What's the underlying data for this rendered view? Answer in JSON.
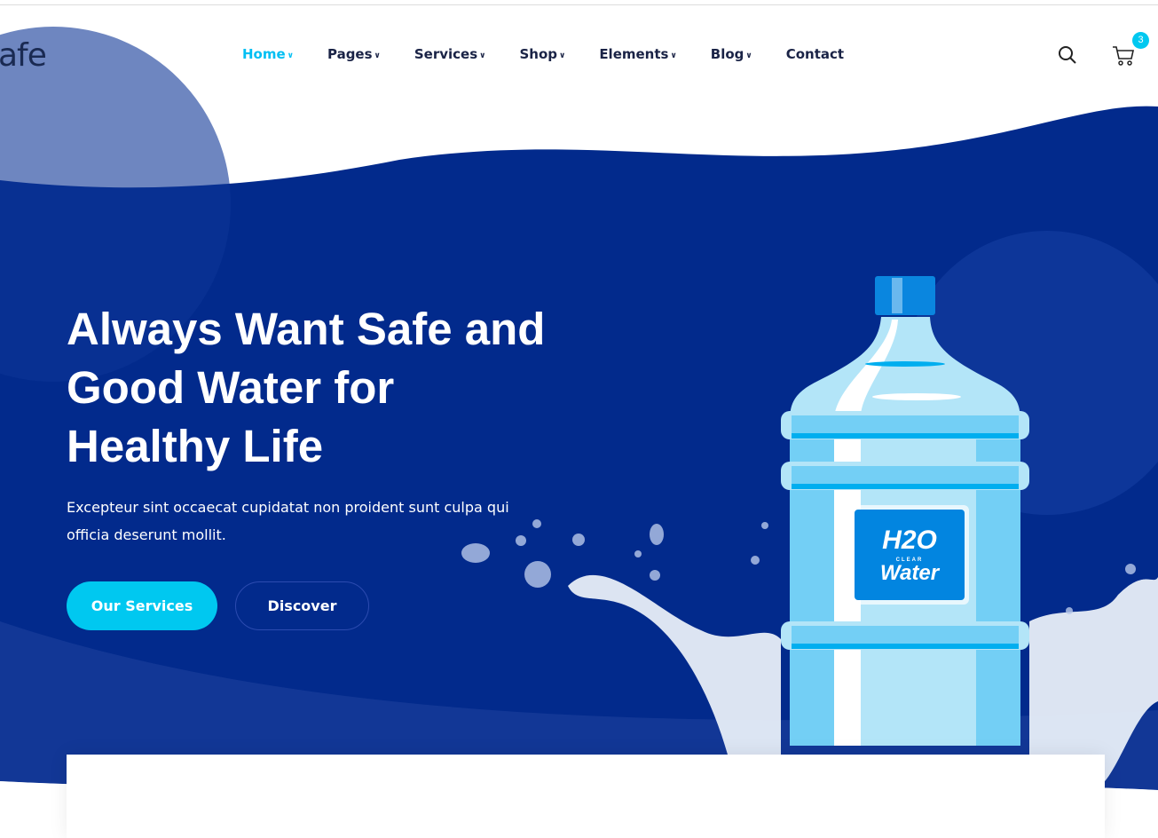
{
  "header": {
    "logo_text": "afe",
    "nav": [
      {
        "label": "Home",
        "dropdown": true,
        "active": true
      },
      {
        "label": "Pages",
        "dropdown": true
      },
      {
        "label": "Services",
        "dropdown": true
      },
      {
        "label": "Shop",
        "dropdown": true
      },
      {
        "label": "Elements",
        "dropdown": true
      },
      {
        "label": "Blog",
        "dropdown": true
      },
      {
        "label": "Contact",
        "dropdown": false
      }
    ],
    "cart_count": "3",
    "icons": [
      "search-icon",
      "cart-icon"
    ]
  },
  "hero": {
    "title": "Always Want Safe and Good Water for Healthy Life",
    "subtitle": "Excepteur sint occaecat cupidatat non proident sunt culpa qui officia deserunt mollit.",
    "primary_button": "Our Services",
    "secondary_button": "Discover",
    "bottle_label": {
      "h2o": "H2O",
      "clear": "CLEAR",
      "water": "Water"
    }
  },
  "colors": {
    "accent": "#00c8f0",
    "hero_bg": "#022a8c",
    "nav_text": "#1a2346"
  }
}
